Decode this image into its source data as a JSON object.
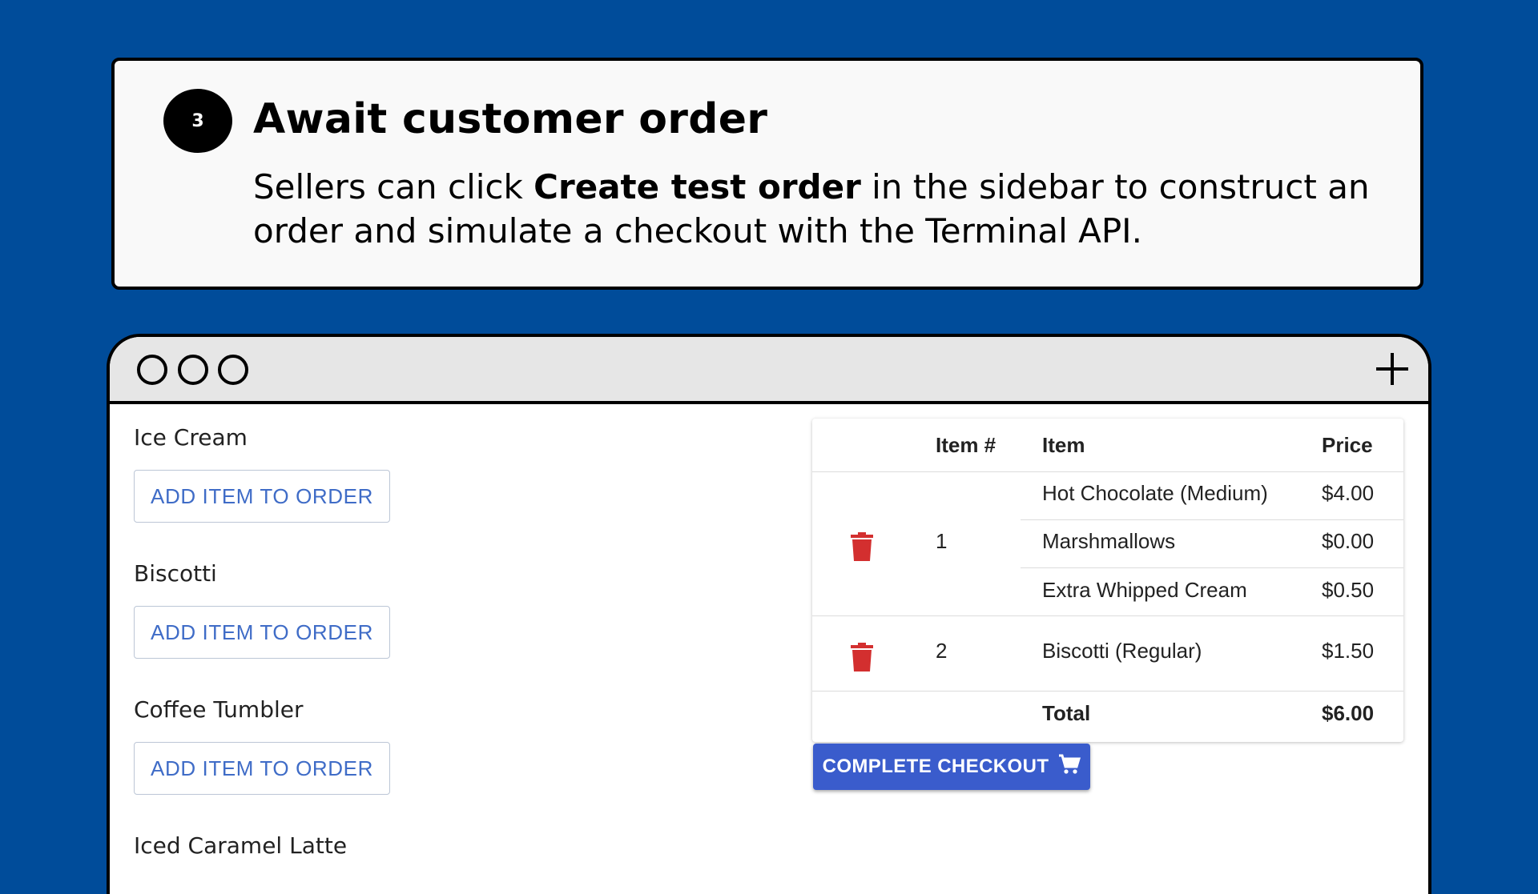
{
  "step": {
    "number": "3",
    "title": "Await customer order",
    "desc_before": "Sellers can click ",
    "desc_bold": "Create test order",
    "desc_after": " in the sidebar to construct an order and simulate a checkout with the Terminal API."
  },
  "products": [
    {
      "name": "Ice Cream",
      "button": "ADD ITEM TO ORDER"
    },
    {
      "name": "Biscotti",
      "button": "ADD ITEM TO ORDER"
    },
    {
      "name": "Coffee Tumbler",
      "button": "ADD ITEM TO ORDER"
    },
    {
      "name": "Iced Caramel Latte"
    }
  ],
  "order_table": {
    "headers": {
      "item_no": "Item #",
      "item": "Item",
      "price": "Price"
    },
    "lines": [
      {
        "item_no": "1",
        "entries": [
          {
            "item": "Hot Chocolate (Medium)",
            "price": "$4.00"
          },
          {
            "item": "Marshmallows",
            "price": "$0.00"
          },
          {
            "item": "Extra Whipped Cream",
            "price": "$0.50"
          }
        ]
      },
      {
        "item_no": "2",
        "entries": [
          {
            "item": "Biscotti (Regular)",
            "price": "$1.50"
          }
        ]
      }
    ],
    "total_label": "Total",
    "total_value": "$6.00"
  },
  "checkout_button": "COMPLETE CHECKOUT",
  "colors": {
    "background": "#004C9A",
    "accent": "#3a5ccc",
    "delete": "#d32f2f"
  },
  "icons": [
    "trash-icon",
    "cart-icon",
    "plus-icon"
  ]
}
